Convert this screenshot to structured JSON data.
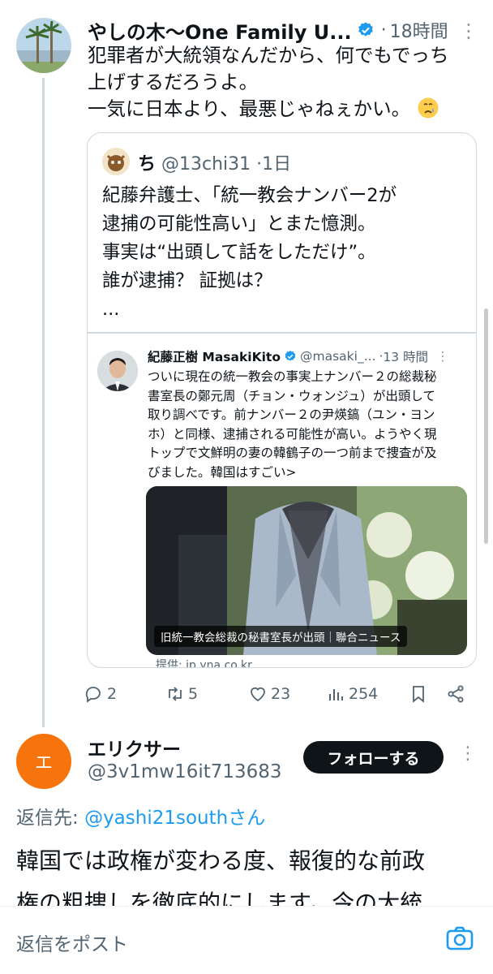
{
  "tweet": {
    "author_name": "やしの木〜One Family U...",
    "time": "18時間",
    "text_lines": [
      "犯罪者が大統領なんだから、何でもでっち",
      "上げするだろうよ。",
      "一気に日本より、最悪じゃねぇかい。"
    ],
    "emoji": "crying-face"
  },
  "quote": {
    "author_name": "ち",
    "handle": "@13chi31",
    "time": "1日",
    "text_lines": [
      "紀藤弁護士、「統一教会ナンバー2が",
      "逮捕の可能性高い」とまた憶測。",
      "事実は“出頭して話をしただけ”。",
      "誰が逮捕？ 証拠は？",
      "..."
    ]
  },
  "nested_quote": {
    "author_name": "紀藤正樹 MasakiKito",
    "handle": "@masaki_...",
    "time": "13 時間",
    "text_lines": [
      "ついに現在の統一教会の事実上ナンバー２の総裁秘",
      "書室長の鄭元周（チョン・ウォンジュ）が出頭して",
      "取り調べです。前ナンバー２の尹煐鎬（ユン・ヨン",
      "ホ）と同様、逮捕される可能性が高い。ようやく現",
      "トップで文鮮明の妻の韓鶴子の一つ前まで捜査が及",
      "びました。韓国はすごい>"
    ],
    "media_caption": "旧統一教会総裁の秘書室長が出頭｜聯合ニュース",
    "source": "提供: jp.yna.co.kr"
  },
  "actions": {
    "replies": "2",
    "reposts": "5",
    "likes": "23",
    "views": "254"
  },
  "reply": {
    "avatar_letter": "エ",
    "author_name": "エリクサー",
    "handle": "@3v1mw16it713683",
    "follow_label": "フォローする",
    "reply_to_prefix": "返信先: ",
    "reply_to_mention": "@yashi21southさん",
    "text_lines": [
      "韓国では政権が変わる度、報復的な前政",
      "権の粗捜しを徹底的にします。今の大統"
    ]
  },
  "composer": {
    "placeholder": "返信をポスト"
  },
  "colors": {
    "accent": "#1d9bf0",
    "avatar_orange": "#f7740c",
    "follow_bg": "#0f1419"
  }
}
